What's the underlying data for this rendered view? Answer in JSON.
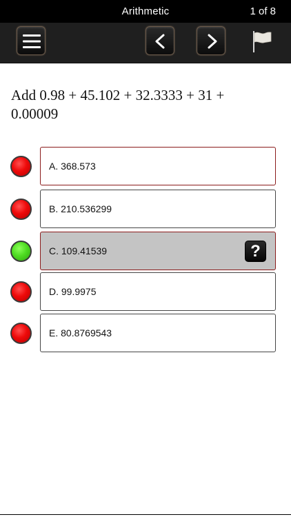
{
  "header": {
    "title": "Arithmetic",
    "counter": "1 of 8"
  },
  "toolbar": {
    "menu_icon": "hamburger-menu-icon",
    "prev_label": "<",
    "next_label": ">",
    "flag_icon": "flag-icon"
  },
  "question": {
    "text": "Add 0.98 + 45.102 + 32.3333 + 31 + 0.00009"
  },
  "answers": [
    {
      "label": "A. 368.573",
      "indicator": "red"
    },
    {
      "label": "B. 210.536299",
      "indicator": "red"
    },
    {
      "label": "C. 109.41539",
      "indicator": "green",
      "selected": true,
      "help_label": "?"
    },
    {
      "label": "D. 99.9975",
      "indicator": "red"
    },
    {
      "label": "E. 80.8769543",
      "indicator": "red"
    }
  ],
  "colors": {
    "red": "#ee0a0a",
    "green": "#4fdc22",
    "selected_bg": "#c4c4c4",
    "header_bg": "#000000",
    "toolbar_bg": "#1f1f1f"
  }
}
